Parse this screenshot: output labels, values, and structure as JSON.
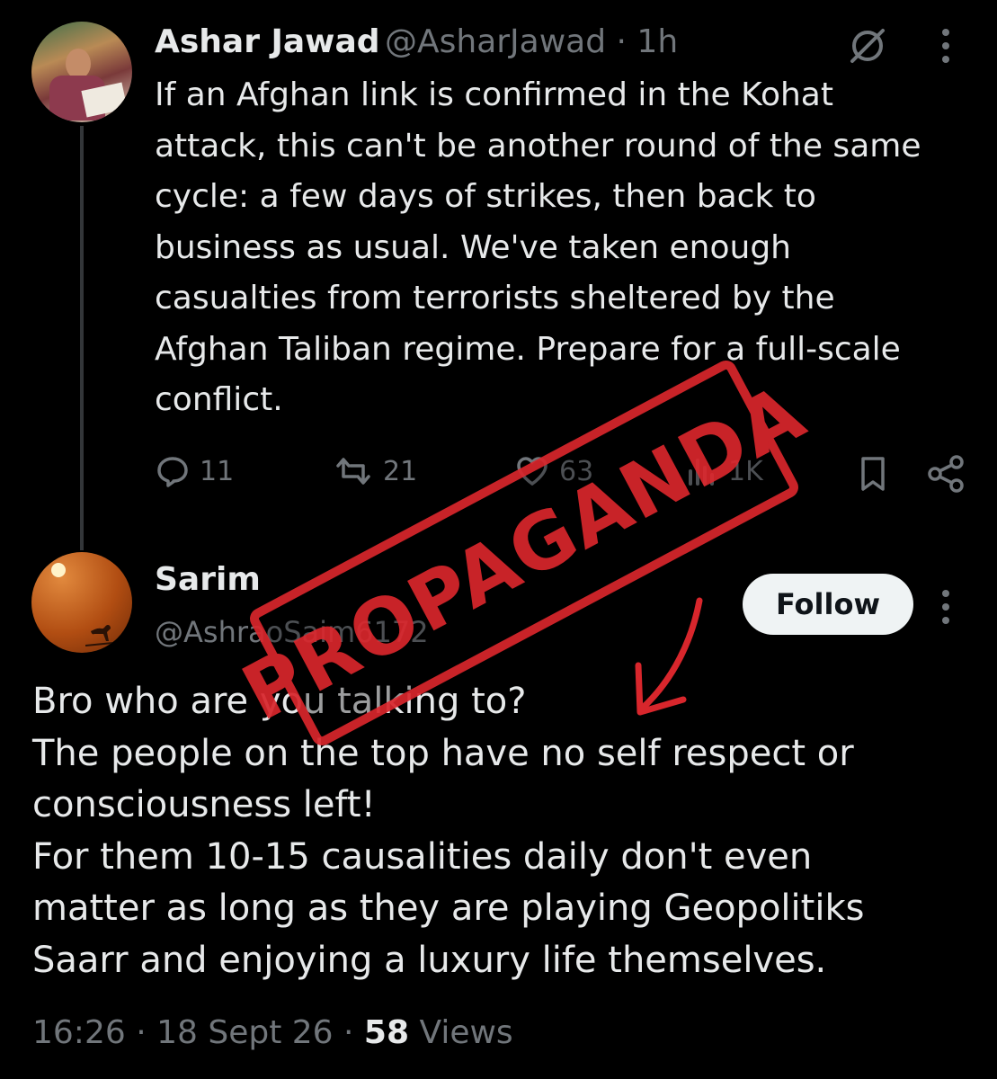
{
  "parent_tweet": {
    "author_name": "Ashar Jawad",
    "author_meta": "@AsharJawad · 1h",
    "text": "If an Afghan link is confirmed in the Kohat\nattack, this can't be another round of the same\ncycle: a few days of strikes, then back to\nbusiness as usual. We've taken enough\ncasualties from terrorists sheltered by the\nAfghan Taliban regime. Prepare for a full-scale\nconflict.",
    "actions": {
      "replies": "11",
      "reposts": "21",
      "likes": "63",
      "views": "1K"
    },
    "icons": [
      "grok-icon",
      "more-icon",
      "reply-icon",
      "retweet-icon",
      "like-icon",
      "views-icon",
      "bookmark-icon",
      "share-icon"
    ]
  },
  "reply_tweet": {
    "author_name": "Sarim",
    "author_handle": "@AshraoSaim6172",
    "follow_label": "Follow",
    "text": "Bro who are you talking to?\nThe people on the top have no self respect or\nconsciousness left!\nFor them 10-15 causalities daily don't even\nmatter as long as they are playing Geopolitiks\nSaarr and enjoying a luxury life themselves.",
    "time": "16:26",
    "date": "18 Sept 26",
    "views_count": "58",
    "views_label": "Views"
  },
  "overlay": {
    "stamp_text": "PROPAGANDA",
    "stamp_color": "#d8262c"
  },
  "colors": {
    "background": "#000000",
    "text_primary": "#e7e9ea",
    "text_secondary": "#71767b",
    "follow_bg": "#eff3f4"
  }
}
